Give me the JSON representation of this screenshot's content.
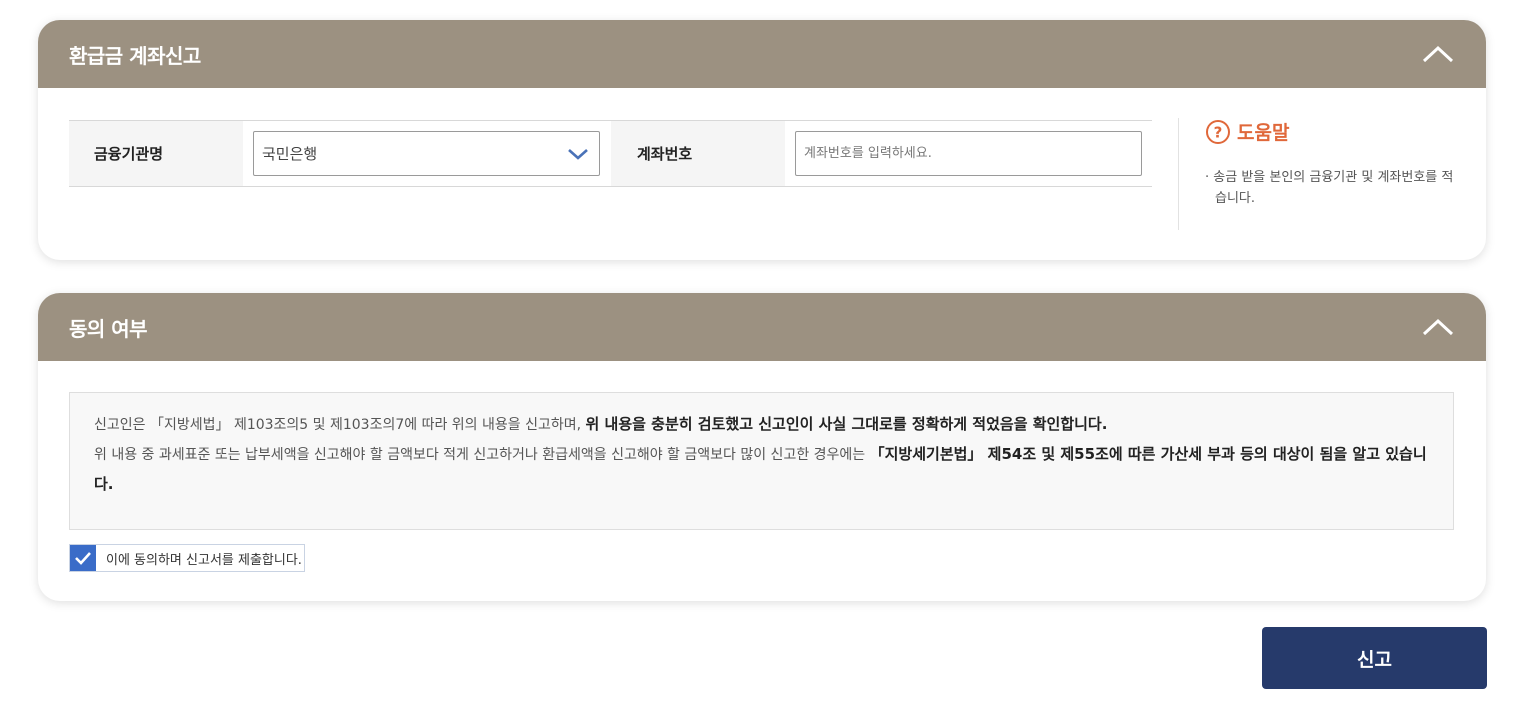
{
  "account_panel": {
    "title": "환급금 계좌신고",
    "bank_label": "금융기관명",
    "bank_selected": "국민은행",
    "account_label": "계좌번호",
    "account_placeholder": "계좌번호를 입력하세요.",
    "account_value": ""
  },
  "help": {
    "title": "도움말",
    "text": "· 송금 받을 본인의 금융기관 및 계좌번호를 적습니다."
  },
  "consent_panel": {
    "title": "동의 여부",
    "line1_normal": "신고인은 「지방세법」 제103조의5 및 제103조의7에 따라 위의 내용을 신고하며, ",
    "line1_bold": "위 내용을 충분히 검토했고 신고인이 사실 그대로를 정확하게 적었음을 확인합니다.",
    "line2_normal": "위 내용 중 과세표준 또는 납부세액을 신고해야 할 금액보다 적게 신고하거나 환급세액을 신고해야 할 금액보다 많이 신고한 경우에는 ",
    "line2_bold": "「지방세기본법」 제54조 및 제55조에 따른 가산세 부과 등의 대상이 됨을 알고 있습니다.",
    "agree_label": "이에 동의하며 신고서를 제출합니다.",
    "agree_checked": true
  },
  "submit_label": "신고",
  "colors": {
    "header_bg": "#9c9181",
    "help_accent": "#e0683a",
    "checkbox": "#3a6cc8",
    "submit_bg": "#263a6b"
  },
  "icons": {
    "collapse": "chevron-up-icon",
    "select": "chevron-down-icon",
    "help": "question-circle-icon",
    "check": "check-icon"
  }
}
